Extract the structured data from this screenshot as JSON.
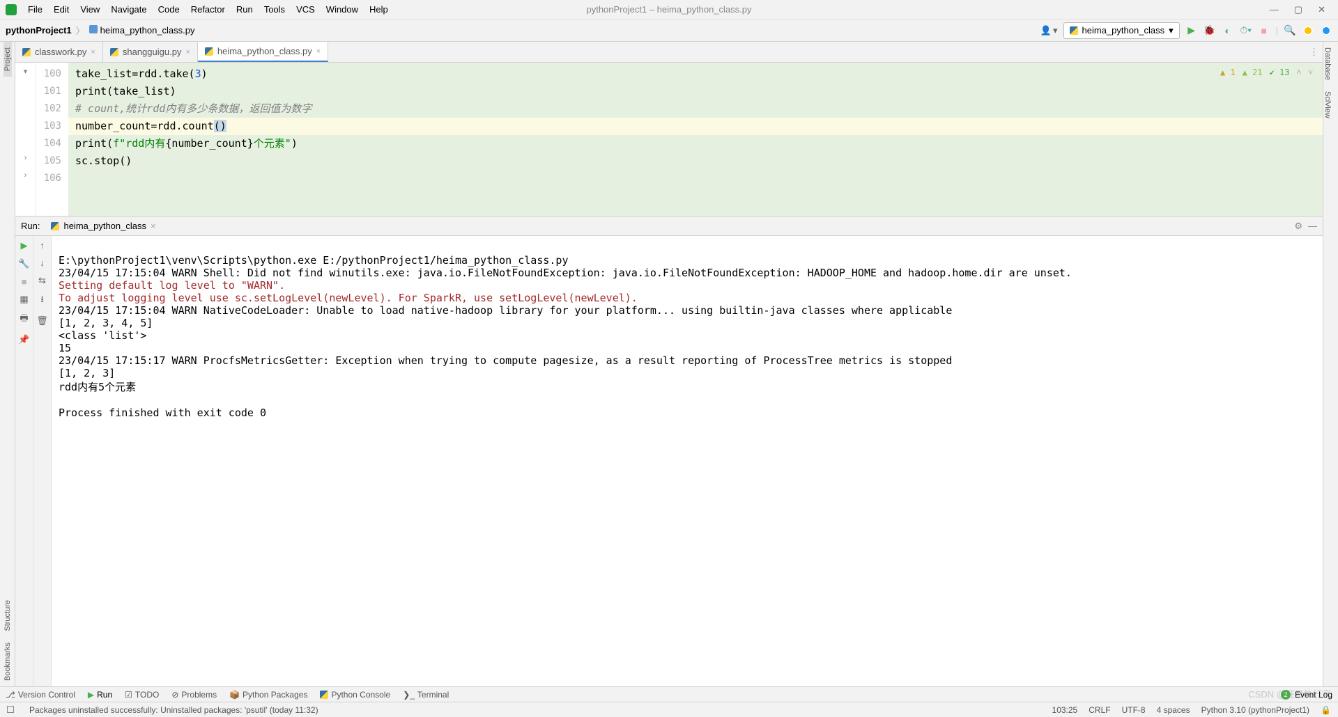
{
  "window": {
    "title": "pythonProject1 – heima_python_class.py"
  },
  "menu": {
    "file": "File",
    "edit": "Edit",
    "view": "View",
    "navigate": "Navigate",
    "code": "Code",
    "refactor": "Refactor",
    "run": "Run",
    "tools": "Tools",
    "vcs": "VCS",
    "window": "Window",
    "help": "Help"
  },
  "breadcrumb": {
    "project": "pythonProject1",
    "file": "heima_python_class.py"
  },
  "toolbar": {
    "run_config": "heima_python_class"
  },
  "tabs": [
    {
      "name": "classwork.py",
      "active": false
    },
    {
      "name": "shangguigu.py",
      "active": false
    },
    {
      "name": "heima_python_class.py",
      "active": true
    }
  ],
  "editor": {
    "lines": {
      "l100": {
        "num": "100",
        "text": "take_list=rdd.take(3)"
      },
      "l101": {
        "num": "101",
        "text": "print(take_list)"
      },
      "l102": {
        "num": "102",
        "text": "# count,统计rdd内有多少条数据，返回值为数字"
      },
      "l103": {
        "num": "103",
        "text": "number_count=rdd.count()"
      },
      "l104": {
        "num": "104",
        "text": "print(f\"rdd内有{number_count}个元素\")"
      },
      "l105": {
        "num": "105",
        "text": "sc.stop()"
      },
      "l106": {
        "num": "106",
        "text": ""
      }
    },
    "inspections": {
      "warn_count": "1",
      "typo_count": "21",
      "check_count": "13"
    }
  },
  "run": {
    "label": "Run:",
    "tab_name": "heima_python_class",
    "console": {
      "l0": "E:\\pythonProject1\\venv\\Scripts\\python.exe E:/pythonProject1/heima_python_class.py",
      "l1": "23/04/15 17:15:04 WARN Shell: Did not find winutils.exe: java.io.FileNotFoundException: java.io.FileNotFoundException: HADOOP_HOME and hadoop.home.dir are unset.",
      "l2": "Setting default log level to \"WARN\".",
      "l3": "To adjust logging level use sc.setLogLevel(newLevel). For SparkR, use setLogLevel(newLevel).",
      "l4": "23/04/15 17:15:04 WARN NativeCodeLoader: Unable to load native-hadoop library for your platform... using builtin-java classes where applicable",
      "l5": "[1, 2, 3, 4, 5]",
      "l6": "<class 'list'>",
      "l7": "15",
      "l8": "23/04/15 17:15:17 WARN ProcfsMetricsGetter: Exception when trying to compute pagesize, as a result reporting of ProcessTree metrics is stopped",
      "l9": "[1, 2, 3]",
      "l10": "rdd内有5个元素",
      "l11": "",
      "l12": "Process finished with exit code 0"
    }
  },
  "bottom_tools": {
    "version_control": "Version Control",
    "run": "Run",
    "todo": "TODO",
    "problems": "Problems",
    "python_packages": "Python Packages",
    "python_console": "Python Console",
    "terminal": "Terminal",
    "event_log": "Event Log",
    "event_count": "2"
  },
  "status": {
    "message": "Packages uninstalled successfully: Uninstalled packages: 'psutil' (today 11:32)",
    "position": "103:25",
    "line_sep": "CRLF",
    "encoding": "UTF-8",
    "indent": "4 spaces",
    "interpreter": "Python 3.10 (pythonProject1)"
  },
  "left_panels": {
    "project": "Project",
    "structure": "Structure",
    "bookmarks": "Bookmarks"
  },
  "right_panels": {
    "database": "Database",
    "sciview": "SciView"
  },
  "watermark": "CSDN @狂暴执行官"
}
